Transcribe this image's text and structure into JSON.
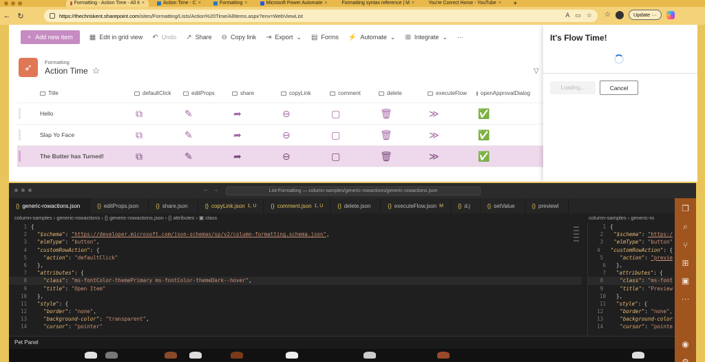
{
  "browser": {
    "tabs": [
      {
        "label": "Formatting - Action Time - All It",
        "active": true,
        "color": "#c05a4a"
      },
      {
        "label": "Action Time - C",
        "active": false,
        "color": "#2a7ab8"
      },
      {
        "label": "Formatting",
        "active": false,
        "color": "#2a7ab8"
      },
      {
        "label": "Microsoft Power Automate",
        "active": false,
        "color": "#2a5ad8"
      },
      {
        "label": "Formatting syntax reference | M",
        "active": false,
        "color": "#3a9a3a"
      },
      {
        "label": "You're Correct Horse - YouTube",
        "active": false,
        "color": "#e03030"
      }
    ],
    "url_host": "https://thechriskent.sharepoint.com",
    "url_path": "/sites/Formatting/Lists/Action%20Time/AllItems.aspx?env=WebViewList",
    "update_label": "Update"
  },
  "sharepoint": {
    "commands": {
      "add": "Add new item",
      "edit_grid": "Edit in grid view",
      "undo": "Undo",
      "share": "Share",
      "copy_link": "Copy link",
      "export": "Export",
      "forms": "Forms",
      "automate": "Automate",
      "integrate": "Integrate",
      "more": "···"
    },
    "site_name": "Formatting",
    "list_name": "Action Time",
    "columns": [
      "Title",
      "defaultClick",
      "editProps",
      "share",
      "copyLink",
      "comment",
      "delete",
      "executeFlow",
      "openApprovalDialog"
    ],
    "rows": [
      {
        "title": "Hello"
      },
      {
        "title": "Slap Yo Face"
      },
      {
        "title": "The Butter has Turned!"
      }
    ],
    "row_icons": [
      "⧉",
      "✎",
      "➦",
      "⊖",
      "▢",
      "🗑",
      "≫",
      "✅"
    ],
    "accent": "#c58bc2"
  },
  "panel": {
    "title": "It's Flow Time!",
    "loading_label": "Loading...",
    "cancel_label": "Cancel"
  },
  "vscode": {
    "search": "List-Formatting — column-samples/generic-rowactions/generic-rowactions.json",
    "tabs": [
      {
        "label": "generic-rowactions.json",
        "active": true,
        "yellow": false,
        "mod": ""
      },
      {
        "label": "editProps.json",
        "active": false,
        "yellow": false,
        "mod": ""
      },
      {
        "label": "share.json",
        "active": false,
        "yellow": false,
        "mod": ""
      },
      {
        "label": "copyLink.json",
        "active": false,
        "yellow": true,
        "mod": "1, U"
      },
      {
        "label": "comment.json",
        "active": false,
        "yellow": true,
        "mod": "1, U"
      },
      {
        "label": "delete.json",
        "active": false,
        "yellow": false,
        "mod": ""
      },
      {
        "label": "executeFlow.json",
        "active": false,
        "yellow": false,
        "mod": "M"
      },
      {
        "label": "d.j",
        "active": false,
        "yellow": false,
        "mod": ""
      },
      {
        "label": "setValue",
        "active": false,
        "yellow": false,
        "mod": ""
      },
      {
        "label": "previewl",
        "active": false,
        "yellow": false,
        "mod": ""
      }
    ],
    "breadcrumb": "column-samples › generic-rowactions › {} generic-rowactions.json › {} attributes › ▣ class",
    "breadcrumb2": "column-samples › generic-ro",
    "lines": [
      {
        "n": "1",
        "html": "<span class='p'>{</span>"
      },
      {
        "n": "2",
        "html": "  <span class='k2'>\"$schema\"</span><span class='p'>: </span><span class='s u'>\"https://developer.microsoft.com/json-schemas/sp/v2/column-formatting.schema.json\"</span><span class='p'>,</span>"
      },
      {
        "n": "3",
        "html": "  <span class='k2'>\"elmType\"</span><span class='p'>: </span><span class='s'>\"button\"</span><span class='p'>,</span>"
      },
      {
        "n": "4",
        "html": "  <span class='k2'>\"customRowAction\"</span><span class='p'>: {</span>"
      },
      {
        "n": "5",
        "html": "    <span class='k2'>\"action\"</span><span class='p'>: </span><span class='s'>\"defaultClick\"</span>"
      },
      {
        "n": "6",
        "html": "  <span class='p'>},</span>"
      },
      {
        "n": "7",
        "html": "  <span class='k2'>\"attributes\"</span><span class='p'>: {</span>"
      },
      {
        "n": "8",
        "html": "    <span class='k2'>\"class\"</span><span class='p'>: </span><span class='s'>\"ms-fontColor-themePrimary ms-fontColor-themeDark--hover\"</span><span class='p'>,</span>"
      },
      {
        "n": "9",
        "html": "    <span class='k2'>\"title\"</span><span class='p'>: </span><span class='s'>\"Open Item\"</span>"
      },
      {
        "n": "10",
        "html": "  <span class='p'>},</span>"
      },
      {
        "n": "11",
        "html": "  <span class='k2'>\"style\"</span><span class='p'>: {</span>"
      },
      {
        "n": "12",
        "html": "    <span class='k2'>\"border\"</span><span class='p'>: </span><span class='s'>\"none\"</span><span class='p'>,</span>"
      },
      {
        "n": "13",
        "html": "    <span class='k2'>\"background-color\"</span><span class='p'>: </span><span class='s'>\"transparent\"</span><span class='p'>,</span>"
      },
      {
        "n": "14",
        "html": "    <span class='k2'>\"cursor\"</span><span class='p'>: </span><span class='s'>\"pointer\"</span>"
      }
    ],
    "lines2": [
      {
        "n": "1",
        "html": "<span class='p'>{</span>"
      },
      {
        "n": "2",
        "html": "  <span class='k2'>\"$schema\"</span><span class='p'>: </span><span class='s u'>\"https:/</span>"
      },
      {
        "n": "3",
        "html": "  <span class='k2'>\"elmType\"</span><span class='p'>: </span><span class='s'>\"button\"</span>"
      },
      {
        "n": "4",
        "html": "  <span class='k2'>\"customRowAction\"</span><span class='p'>: {</span>"
      },
      {
        "n": "5",
        "html": "    <span class='k2'>\"action\"</span><span class='p'>: </span><span class='s u'>\"previe</span>"
      },
      {
        "n": "6",
        "html": "  <span class='p'>},</span>"
      },
      {
        "n": "7",
        "html": "  <span class='k2'>\"attributes\"</span><span class='p'>: {</span>"
      },
      {
        "n": "8",
        "html": "    <span class='k2'>\"class\"</span><span class='p'>: </span><span class='s'>\"ms-font</span>"
      },
      {
        "n": "9",
        "html": "    <span class='k2'>\"title\"</span><span class='p'>: </span><span class='s'>\"Preview</span>"
      },
      {
        "n": "10",
        "html": "  <span class='p'>},</span>"
      },
      {
        "n": "11",
        "html": "  <span class='k2'>\"style\"</span><span class='p'>: {</span>"
      },
      {
        "n": "12",
        "html": "    <span class='k2'>\"border\"</span><span class='p'>: </span><span class='s'>\"none\",</span>"
      },
      {
        "n": "13",
        "html": "    <span class='k2'>\"background-color</span>"
      },
      {
        "n": "14",
        "html": "    <span class='k2'>\"cursor\"</span><span class='p'>: </span><span class='s'>\"pointe</span>"
      }
    ],
    "bottom_tab": "Pet Panel",
    "activity_color": "#a0541e"
  }
}
